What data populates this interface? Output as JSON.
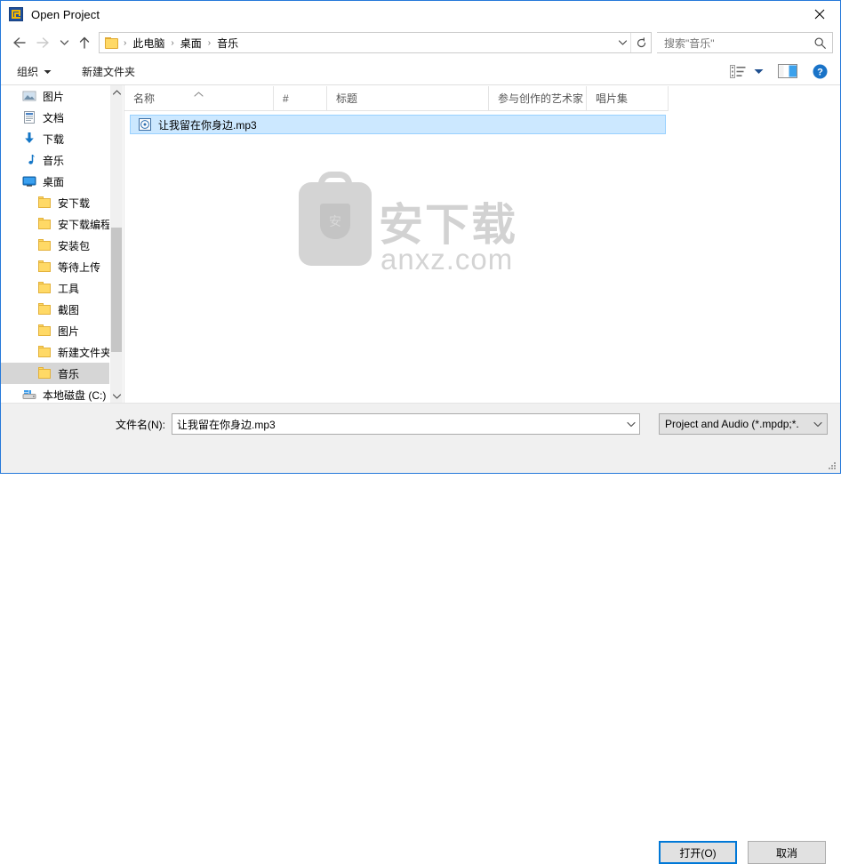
{
  "window": {
    "title": "Open Project",
    "app_icon": "project-app-icon",
    "close_label": "✕",
    "accent": "#2579da"
  },
  "nav": {
    "back": "back-arrow",
    "forward": "forward-arrow",
    "recent": "recent-locations-chevron",
    "up": "up-arrow",
    "breadcrumb": [
      "此电脑",
      "桌面",
      "音乐"
    ],
    "separator": "›",
    "dropdown": "address-dropdown-chevron",
    "refresh": "refresh-icon"
  },
  "search": {
    "placeholder": "搜索\"音乐\"",
    "icon": "search-icon"
  },
  "commandbar": {
    "organize": "组织",
    "new_folder": "新建文件夹",
    "view_icon": "view-layout-icon",
    "view_caret": "view-dropdown-caret",
    "pane_icon": "preview-pane-icon",
    "help_icon": "help-icon"
  },
  "sidebar": {
    "items": [
      {
        "label": "图片",
        "icon": "pictures-icon",
        "level": 1,
        "selected": false
      },
      {
        "label": "文档",
        "icon": "documents-icon",
        "level": 1,
        "selected": false
      },
      {
        "label": "下载",
        "icon": "downloads-icon",
        "level": 1,
        "selected": false
      },
      {
        "label": "音乐",
        "icon": "music-icon",
        "level": 1,
        "selected": false
      },
      {
        "label": "桌面",
        "icon": "desktop-icon",
        "level": 1,
        "selected": false
      },
      {
        "label": "安下载",
        "icon": "folder-icon",
        "level": 2,
        "selected": false
      },
      {
        "label": "安下载编程备份",
        "icon": "folder-icon",
        "level": 2,
        "selected": false
      },
      {
        "label": "安装包",
        "icon": "folder-icon",
        "level": 2,
        "selected": false
      },
      {
        "label": "等待上传",
        "icon": "folder-icon",
        "level": 2,
        "selected": false
      },
      {
        "label": "工具",
        "icon": "folder-icon",
        "level": 2,
        "selected": false
      },
      {
        "label": "截图",
        "icon": "folder-icon",
        "level": 2,
        "selected": false
      },
      {
        "label": "图片",
        "icon": "folder-icon",
        "level": 2,
        "selected": false
      },
      {
        "label": "新建文件夹",
        "icon": "folder-icon",
        "level": 2,
        "selected": false
      },
      {
        "label": "音乐",
        "icon": "folder-icon",
        "level": 2,
        "selected": true
      },
      {
        "label": "本地磁盘 (C:)",
        "icon": "drive-icon",
        "level": 1,
        "selected": false
      }
    ],
    "scroll_up": "scroll-up-arrow",
    "scroll_down": "scroll-down-arrow"
  },
  "filelist": {
    "columns": [
      {
        "label": "名称",
        "width": 168,
        "sorted": true
      },
      {
        "label": "#",
        "width": 60,
        "sorted": false
      },
      {
        "label": "标题",
        "width": 182,
        "sorted": false
      },
      {
        "label": "参与创作的艺术家",
        "width": 110,
        "sorted": false
      },
      {
        "label": "唱片集",
        "width": 92,
        "sorted": false
      }
    ],
    "sort_indicator": "sort-ascending-caret",
    "rows": [
      {
        "name": "让我留在你身边.mp3",
        "icon": "audio-file-icon",
        "selected": true
      }
    ]
  },
  "watermark": {
    "cn": "安下载",
    "en": "anxz.com",
    "badge_char": "安"
  },
  "footer": {
    "filename_label": "文件名(N):",
    "filename_value": "让我留在你身边.mp3",
    "filename_dropdown": "filename-history-caret",
    "filter_value": "Project and Audio (*.mpdp;*.",
    "filter_dropdown": "filter-dropdown-caret",
    "open_button": "打开(O)",
    "cancel_button": "取消"
  }
}
